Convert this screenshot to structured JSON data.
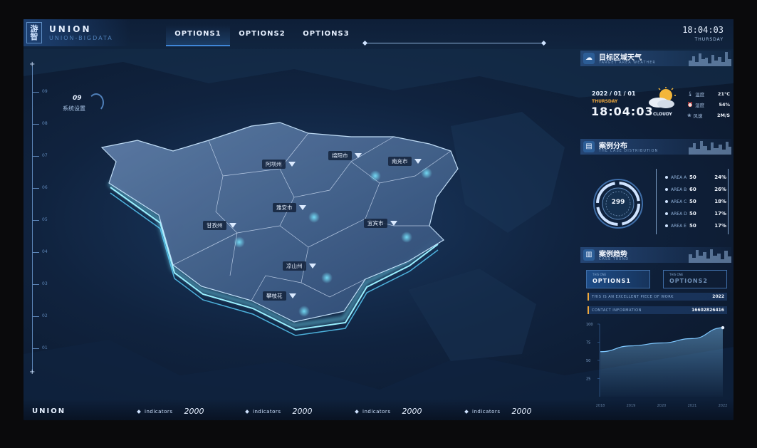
{
  "header": {
    "logo_text": "游\n智",
    "brand_title": "UNION",
    "brand_sub": "UNION-BIGDATA",
    "tabs": [
      {
        "label": "OPTIONS1"
      },
      {
        "label": "OPTIONS2"
      },
      {
        "label": "OPTIONS3"
      }
    ],
    "clock": "18:04:03",
    "day": "THURSDAY"
  },
  "ruler": {
    "ticks": [
      "09",
      "08",
      "07",
      "06",
      "05",
      "04",
      "03",
      "02",
      "01"
    ]
  },
  "settings": {
    "number": "09",
    "label": "系统设置"
  },
  "map": {
    "cities": [
      {
        "name": "阿坝州"
      },
      {
        "name": "绵阳市"
      },
      {
        "name": "南充市"
      },
      {
        "name": "雅安市"
      },
      {
        "name": "甘孜州"
      },
      {
        "name": "宜宾市"
      },
      {
        "name": "凉山州"
      },
      {
        "name": "攀枝花"
      }
    ]
  },
  "weather": {
    "title": "目标区域天气",
    "subtitle": "TARGET AREA WEATHER",
    "date": "2022 / 01 / 01",
    "day": "THURSDAY",
    "time": "18:04:03",
    "condition": "CLOUDY",
    "rows": [
      {
        "label": "温度",
        "value": "21°C"
      },
      {
        "label": "湿度",
        "value": "54%"
      },
      {
        "label": "风速",
        "value": "2M/S"
      }
    ]
  },
  "cases": {
    "title": "案例分布",
    "subtitle": "THE CASE DISTRIBUTION",
    "total": "299",
    "areas": [
      {
        "name": "AREA A",
        "count": "50",
        "pct": "24%"
      },
      {
        "name": "AREA B",
        "count": "60",
        "pct": "26%"
      },
      {
        "name": "AREA C",
        "count": "50",
        "pct": "18%"
      },
      {
        "name": "AREA D",
        "count": "50",
        "pct": "17%"
      },
      {
        "name": "AREA E",
        "count": "50",
        "pct": "17%"
      }
    ]
  },
  "trend": {
    "title": "案例趋势",
    "subtitle": "CASE TREND",
    "tabs": [
      {
        "small": "THIS ONE",
        "label": "OPTIONS1"
      },
      {
        "small": "THIS ONE",
        "label": "OPTIONS2"
      }
    ],
    "info": [
      {
        "text": "THIS IS AN EXCELLENT PIECE OF WORK",
        "value": "2022"
      },
      {
        "text": "CONTACT INFORMATION",
        "value": "16602826416"
      }
    ]
  },
  "chart_data": {
    "type": "area",
    "x": [
      "2018",
      "2019",
      "2020",
      "2021",
      "2022"
    ],
    "values": [
      62,
      70,
      74,
      80,
      95
    ],
    "ylim": [
      0,
      100
    ],
    "yticks": [
      "100",
      "75",
      "50",
      "25"
    ],
    "accent": "#7fc8ff"
  },
  "footer": {
    "brand": "UNION",
    "items": [
      {
        "label": "indicators",
        "value": "2000"
      },
      {
        "label": "indicators",
        "value": "2000"
      },
      {
        "label": "indicators",
        "value": "2000"
      },
      {
        "label": "indicators",
        "value": "2000"
      }
    ]
  },
  "colors": {
    "accent": "#3f86d8",
    "warning": "#f0a93c",
    "glow": "#78e6ff"
  }
}
